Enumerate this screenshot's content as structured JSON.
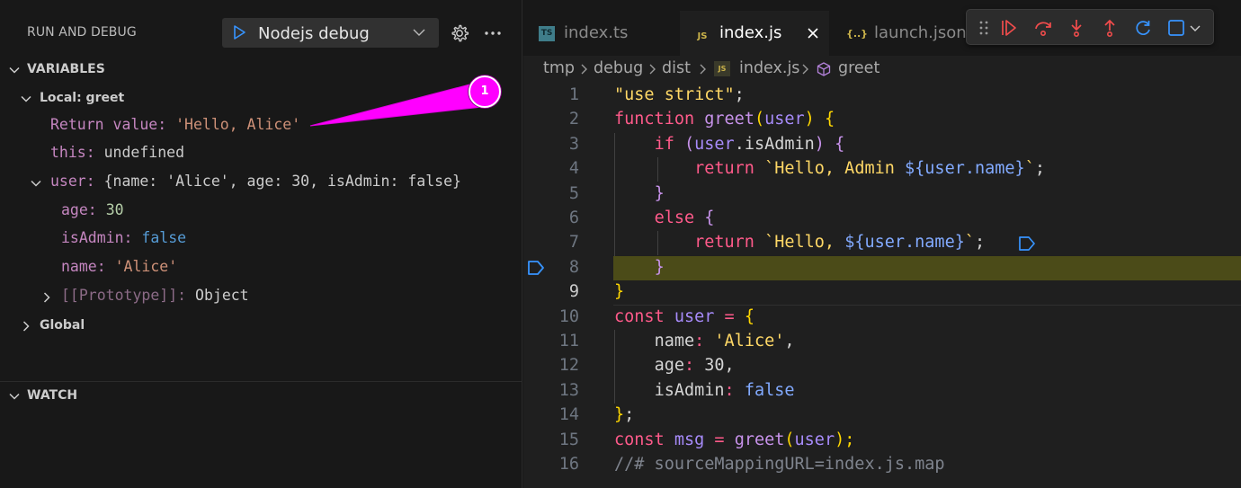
{
  "sidebar": {
    "title": "RUN AND DEBUG",
    "debug_config": "Nodejs debug",
    "variables_header": "VARIABLES",
    "watch_header": "WATCH",
    "local_scope": "Local: greet",
    "global_scope": "Global",
    "return_value": {
      "key": "Return value:",
      "value": "'Hello, Alice'"
    },
    "this_var": {
      "key": "this:",
      "value": "undefined"
    },
    "user_var": {
      "key": "user:",
      "value": "{name: 'Alice', age: 30, isAdmin: false}"
    },
    "user_age": {
      "key": "age:",
      "value": "30"
    },
    "user_isadmin": {
      "key": "isAdmin:",
      "value": "false"
    },
    "user_name": {
      "key": "name:",
      "value": "'Alice'"
    },
    "user_proto": {
      "key": "[[Prototype]]:",
      "value": "Object"
    }
  },
  "tabs": [
    {
      "label": "index.ts",
      "icon": "TS"
    },
    {
      "label": "index.js",
      "icon": "JS"
    },
    {
      "label": "launch.json",
      "icon": "{..}"
    }
  ],
  "breadcrumb": [
    "tmp",
    "debug",
    "dist",
    "index.js",
    "greet"
  ],
  "annotation": {
    "badge": "1"
  },
  "code": {
    "current_line": 9,
    "highlight_line": 8,
    "lines": [
      {
        "n": "1"
      },
      {
        "n": "2"
      },
      {
        "n": "3"
      },
      {
        "n": "4"
      },
      {
        "n": "5"
      },
      {
        "n": "6"
      },
      {
        "n": "7"
      },
      {
        "n": "8"
      },
      {
        "n": "9"
      },
      {
        "n": "10"
      },
      {
        "n": "11"
      },
      {
        "n": "12"
      },
      {
        "n": "13"
      },
      {
        "n": "14"
      },
      {
        "n": "15"
      },
      {
        "n": "16"
      }
    ],
    "tokens": {
      "l1": [
        "\"use strict\"",
        ";"
      ],
      "l2": [
        "function",
        "greet",
        "(",
        "user",
        ")",
        "{"
      ],
      "l3": [
        "if",
        "(",
        "user",
        ".isAdmin",
        ")",
        "{"
      ],
      "l4": [
        "return",
        "`Hello, Admin ",
        "${",
        "user.name",
        "}",
        "`",
        ";"
      ],
      "l5": [
        "}"
      ],
      "l6": [
        "else",
        "{"
      ],
      "l7": [
        "return",
        "`Hello, ",
        "${",
        "user.name",
        "}",
        "`",
        ";"
      ],
      "l8": [
        "}"
      ],
      "l9": [
        "}"
      ],
      "l10": [
        "const",
        "user",
        "=",
        "{"
      ],
      "l11": [
        "name",
        ":",
        "'Alice'",
        ","
      ],
      "l12": [
        "age",
        ":",
        "30",
        ","
      ],
      "l13": [
        "isAdmin",
        ":",
        "false"
      ],
      "l14": [
        "}",
        ";"
      ],
      "l15": [
        "const",
        "msg",
        "=",
        "greet",
        "(",
        "user",
        ");"
      ],
      "l16": [
        "//# sourceMappingURL=index.js.map"
      ]
    }
  },
  "colors": {
    "accent": "#ff00ff",
    "highlight": "#4b4b18",
    "debug_icon": "#f14c4c"
  }
}
